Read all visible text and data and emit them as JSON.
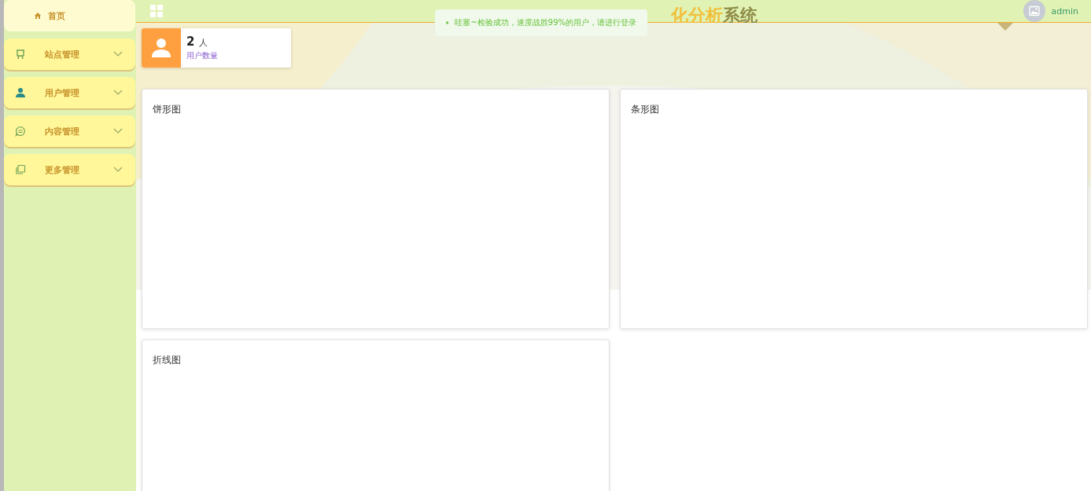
{
  "sidebar": {
    "items": [
      {
        "label": "首页",
        "kind": "link",
        "selected": true
      },
      {
        "label": "站点管理",
        "kind": "submenu",
        "selected": false
      },
      {
        "label": "用户管理",
        "kind": "submenu",
        "selected": false
      },
      {
        "label": "内容管理",
        "kind": "submenu",
        "selected": false
      },
      {
        "label": "更多管理",
        "kind": "submenu",
        "selected": false
      }
    ]
  },
  "header": {
    "title_parts": [
      {
        "text": "化分析",
        "color": "#f2bf3a"
      },
      {
        "text": "系统",
        "color": "#8f8c48"
      }
    ],
    "user": "admin"
  },
  "toast": {
    "message": "哇塞~检验成功，速度战胜99%的用户，请进行登录"
  },
  "stat_card": {
    "value": "2",
    "unit": "人",
    "label": "用户数量"
  },
  "charts": [
    {
      "title": "饼形图"
    },
    {
      "title": "条形图"
    },
    {
      "title": "折线图"
    }
  ]
}
